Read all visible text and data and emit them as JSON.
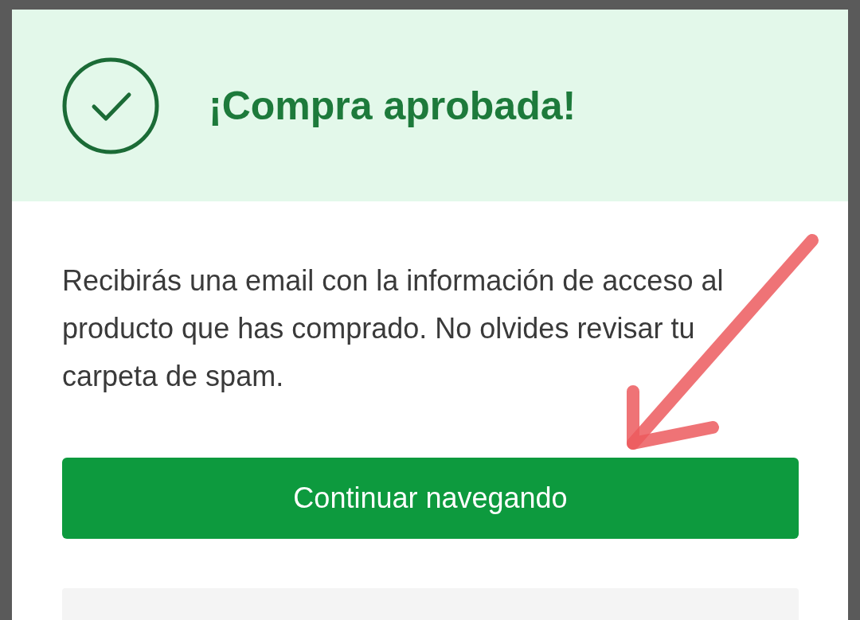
{
  "banner": {
    "title": "¡Compra aprobada!"
  },
  "message": "Recibirás una email con la información de acceso al producto que has comprado. No olvides revisar tu carpeta de spam.",
  "button": {
    "label": "Continuar navegando"
  }
}
